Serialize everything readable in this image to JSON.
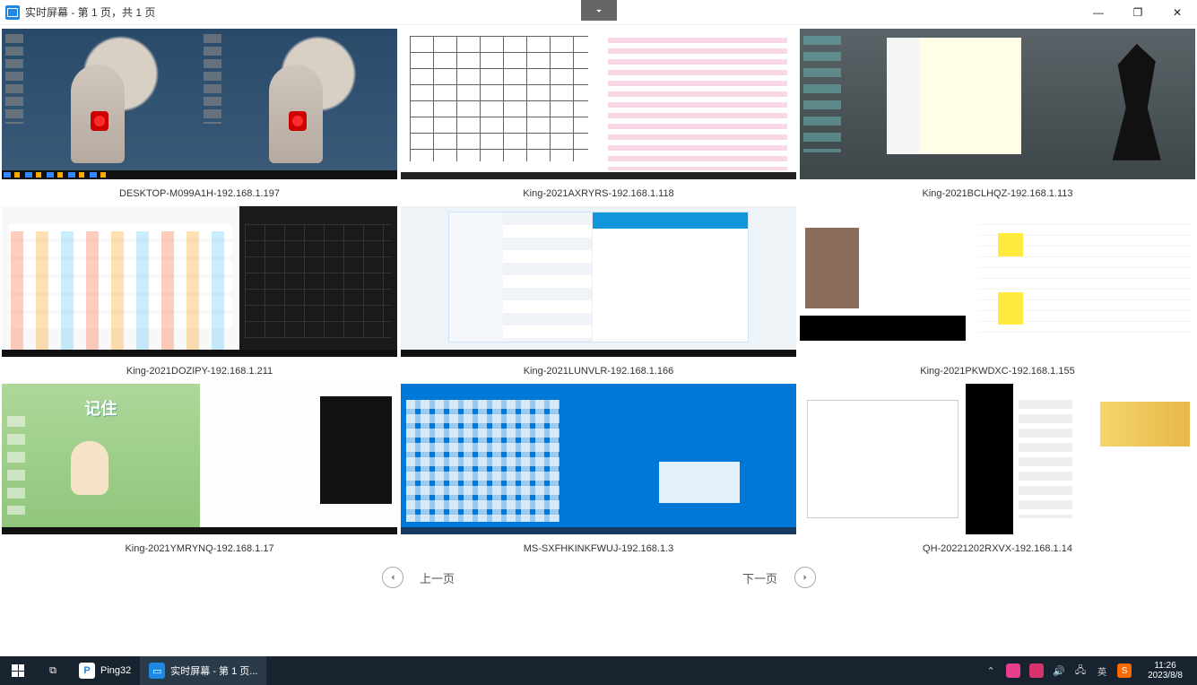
{
  "window": {
    "title": "实时屏幕 - 第 1 页，共 1 页",
    "dropdown_icon": "chevron-down"
  },
  "win_controls": {
    "minimize": "—",
    "maximize": "❐",
    "close": "✕"
  },
  "screens": [
    {
      "label": "DESKTOP-M099A1H-192.168.1.197",
      "style": "desk"
    },
    {
      "label": "King-2021AXRYRS-192.168.1.118",
      "style": "cad"
    },
    {
      "label": "King-2021BCLHQZ-192.168.1.113",
      "style": "anime"
    },
    {
      "label": "King-2021DOZIPY-192.168.1.211",
      "style": "browser"
    },
    {
      "label": "King-2021LUNVLR-192.168.1.166",
      "style": "chat"
    },
    {
      "label": "King-2021PKWDXC-192.168.1.155",
      "style": "excel"
    },
    {
      "label": "King-2021YMRYNQ-192.168.1.17",
      "style": "monk"
    },
    {
      "label": "MS-SXFHKINKFWUJ-192.168.1.3",
      "style": "winblue"
    },
    {
      "label": "QH-20221202RXVX-192.168.1.14",
      "style": "multi"
    }
  ],
  "pagination": {
    "prev": "上一页",
    "next": "下一页"
  },
  "taskbar": {
    "apps": [
      {
        "name": "Ping32",
        "icon_bg": "#ffffff",
        "icon_fg": "#1e88e5",
        "glyph": "P",
        "active": false
      },
      {
        "name": "实时屏幕 - 第 1 页...",
        "icon_bg": "#1e88e5",
        "icon_fg": "#ffffff",
        "glyph": "▭",
        "active": true
      }
    ],
    "tray": {
      "icons": [
        "expand-tray",
        "shield-icon",
        "app-b-icon",
        "volume-icon",
        "network-icon",
        "ime-zh-icon",
        "sogou-icon"
      ],
      "ime": "英"
    },
    "clock": {
      "time": "11:26",
      "date": "2023/8/8"
    }
  }
}
